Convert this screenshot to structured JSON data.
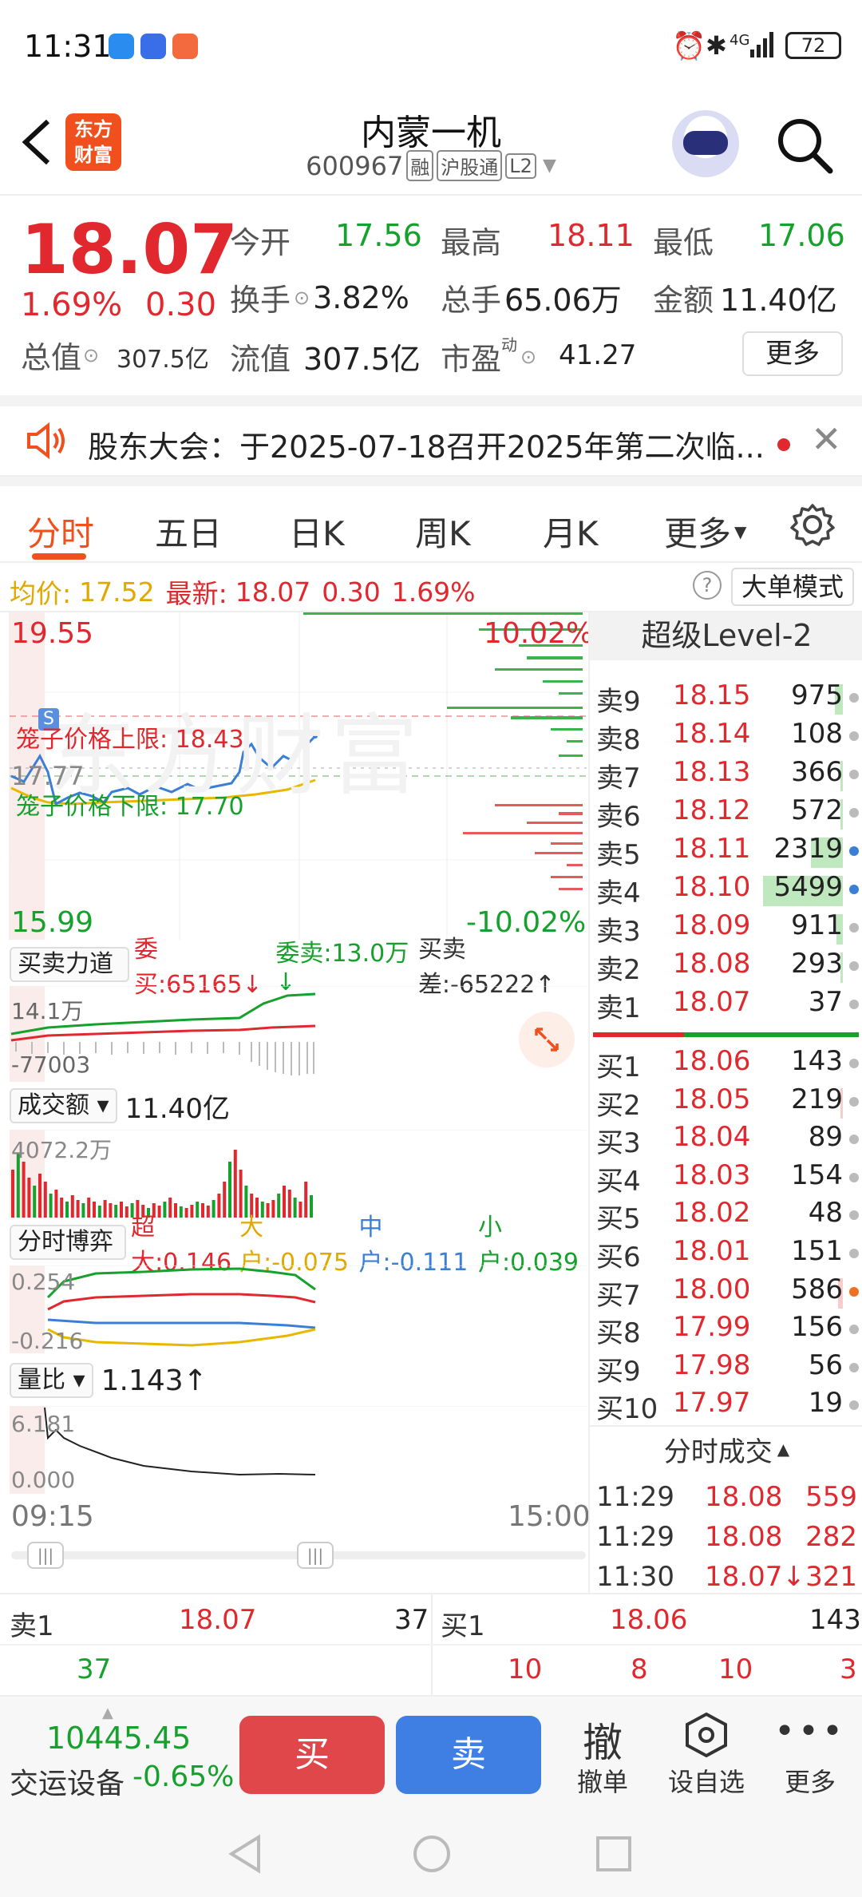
{
  "status_bar": {
    "time": "11:31",
    "network": "4G",
    "battery": "72"
  },
  "header": {
    "logo_line1": "东方",
    "logo_line2": "财富",
    "stock_name": "内蒙一机",
    "stock_code": "600967",
    "tags": [
      "融",
      "沪股通",
      "L2"
    ]
  },
  "quote": {
    "price": "18.07",
    "change_pct": "1.69%",
    "change_amt": "0.30",
    "open_label": "今开",
    "open": "17.56",
    "high_label": "最高",
    "high": "18.11",
    "low_label": "最低",
    "low": "17.06",
    "turnover_label": "换手",
    "turnover": "3.82%",
    "volume_label": "总手",
    "volume": "65.06万",
    "amount_label": "金额",
    "amount": "11.40亿",
    "total_cap_label": "总值",
    "total_cap": "307.5亿",
    "float_cap_label": "流值",
    "float_cap": "307.5亿",
    "pe_label": "市盈",
    "pe_super": "动",
    "pe": "41.27",
    "more_label": "更多"
  },
  "notice": {
    "text": "股东大会：于2025-07-18召开2025年第二次临..."
  },
  "tabs": [
    "分时",
    "五日",
    "日K",
    "周K",
    "月K",
    "更多"
  ],
  "avg_line": {
    "avg_label": "均价:",
    "avg": "17.52",
    "latest_label": "最新:",
    "latest": "18.07",
    "chg": "0.30",
    "pct": "1.69%",
    "help": "?",
    "big_order_mode": "大单模式"
  },
  "main_chart": {
    "y_max": "19.55",
    "y_min": "15.99",
    "pct_max": "10.02%",
    "pct_min": "-10.02%",
    "y_mid": "17.77",
    "upper_limit_label": "笼子价格上限: 18.43",
    "lower_limit_label": "笼子价格下限: 17.70",
    "watermark": "东方财富",
    "marker": "S"
  },
  "buy_sell_force": {
    "dropdown": "买卖力道",
    "entrust_buy": "委买:65165↓",
    "entrust_sell": "委卖:13.0万↓",
    "diff": "买卖差:-65222↑",
    "top": "14.1万",
    "bottom": "-77003"
  },
  "turnover_chart": {
    "dropdown": "成交额",
    "value": "11.40亿",
    "top": "4072.2万"
  },
  "game_chart": {
    "dropdown": "分时博弈",
    "super": "超大:0.146",
    "large": "大户:-0.075",
    "mid": "中户:-0.111",
    "small": "小户:0.039",
    "top": "0.254",
    "bottom": "-0.216"
  },
  "volume_ratio": {
    "dropdown": "量比",
    "value": "1.143↑",
    "top": "6.181",
    "bottom": "0.000"
  },
  "time_axis": {
    "start": "09:15",
    "end": "15:00"
  },
  "level2": {
    "title": "超级Level-2",
    "asks": [
      {
        "label": "卖9",
        "price": "18.15",
        "vol": "975",
        "bar": 0.1
      },
      {
        "label": "卖8",
        "price": "18.14",
        "vol": "108",
        "bar": 0.0
      },
      {
        "label": "卖7",
        "price": "18.13",
        "vol": "366",
        "bar": 0.03
      },
      {
        "label": "卖6",
        "price": "18.12",
        "vol": "572",
        "bar": 0.03
      },
      {
        "label": "卖5",
        "price": "18.11",
        "vol": "2319",
        "bar": 0.4
      },
      {
        "label": "卖4",
        "price": "18.10",
        "vol": "5499",
        "bar": 1.0
      },
      {
        "label": "卖3",
        "price": "18.09",
        "vol": "911",
        "bar": 0.08
      },
      {
        "label": "卖2",
        "price": "18.08",
        "vol": "293",
        "bar": 0.03
      },
      {
        "label": "卖1",
        "price": "18.07",
        "vol": "37",
        "bar": 0.0
      }
    ],
    "bids": [
      {
        "label": "买1",
        "price": "18.06",
        "vol": "143",
        "bar": 0.0
      },
      {
        "label": "买2",
        "price": "18.05",
        "vol": "219",
        "bar": 0.03
      },
      {
        "label": "买3",
        "price": "18.04",
        "vol": "89",
        "bar": 0.0
      },
      {
        "label": "买4",
        "price": "18.03",
        "vol": "154",
        "bar": 0.0
      },
      {
        "label": "买5",
        "price": "18.02",
        "vol": "48",
        "bar": 0.0
      },
      {
        "label": "买6",
        "price": "18.01",
        "vol": "151",
        "bar": 0.0
      },
      {
        "label": "买7",
        "price": "18.00",
        "vol": "586",
        "bar": 0.06
      },
      {
        "label": "买8",
        "price": "17.99",
        "vol": "156",
        "bar": 0.0
      },
      {
        "label": "买9",
        "price": "17.98",
        "vol": "56",
        "bar": 0.0
      },
      {
        "label": "买10",
        "price": "17.97",
        "vol": "19",
        "bar": 0.0
      }
    ],
    "trades_title": "分时成交",
    "trades": [
      {
        "time": "11:29",
        "price": "18.08",
        "vol": "559"
      },
      {
        "time": "11:29",
        "price": "18.08",
        "vol": "282"
      },
      {
        "time": "11:30",
        "price": "18.07↓",
        "vol": "321"
      }
    ]
  },
  "mini_book": {
    "sell_label": "卖1",
    "sell_price": "18.07",
    "sell_vol": "37",
    "sell_queue": [
      "37"
    ],
    "buy_label": "买1",
    "buy_price": "18.06",
    "buy_vol": "143",
    "buy_queue": [
      "10",
      "8",
      "10",
      "3"
    ]
  },
  "bottom_bar": {
    "index_value": "10445.45",
    "index_name": "交运设备",
    "index_pct": "-0.65%",
    "buy": "买",
    "sell": "卖",
    "cancel_big": "撤",
    "cancel": "撤单",
    "watchlist": "设自选",
    "more": "更多"
  },
  "colors": {
    "up": "#e0282e",
    "down": "#16a02c",
    "brand": "#f0501e",
    "sell_btn": "#3f7fe4",
    "buy_btn": "#e0474a"
  }
}
